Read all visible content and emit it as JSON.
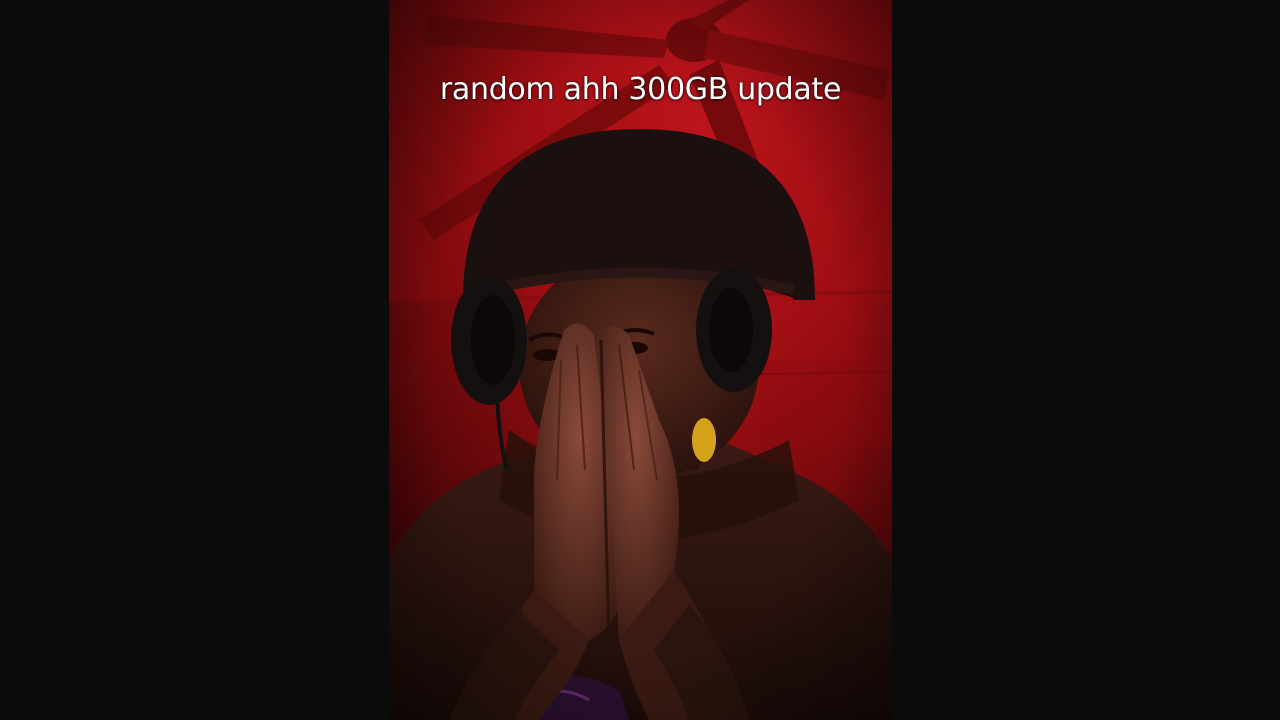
{
  "video": {
    "caption": "random ahh 300GB update"
  },
  "colors": {
    "letterbox": "#0b0b0b",
    "room_light": "#b3121a",
    "room_dark": "#4a0506",
    "caption_text": "#ffffff"
  }
}
